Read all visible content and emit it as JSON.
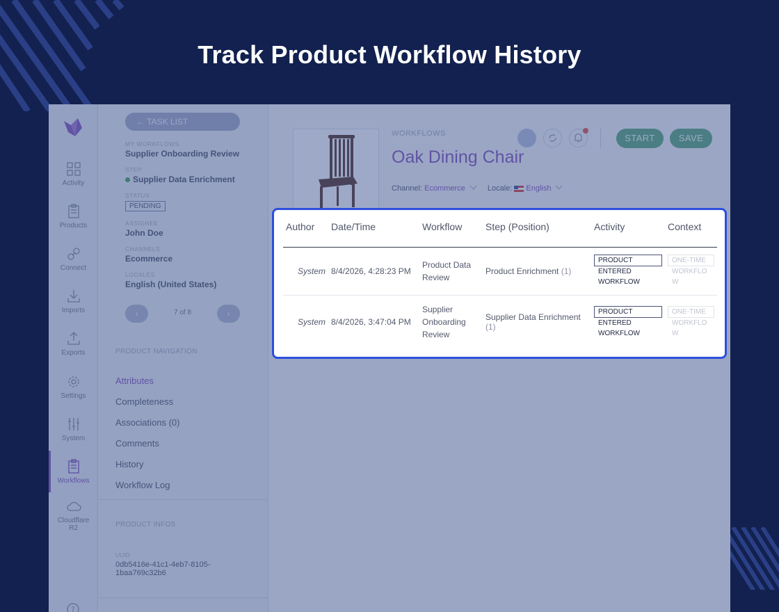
{
  "headline": "Track Product Workflow History",
  "sidebar_nav": [
    {
      "label": "Activity",
      "icon": "grid-icon"
    },
    {
      "label": "Products",
      "icon": "clipboard-icon"
    },
    {
      "label": "Connect",
      "icon": "link-icon"
    },
    {
      "label": "Imports",
      "icon": "import-icon"
    },
    {
      "label": "Exports",
      "icon": "export-icon"
    },
    {
      "label": "Settings",
      "icon": "gear-icon"
    },
    {
      "label": "System",
      "icon": "sliders-icon"
    },
    {
      "label": "Workflows",
      "icon": "workflow-clipboard-icon",
      "active": true
    },
    {
      "label": "Cloudflare R2",
      "icon": "cloud-icon"
    }
  ],
  "task_panel": {
    "back_label": "← TASK LIST",
    "my_workflows_label": "MY WORKFLOWS",
    "my_workflows_value": "Supplier Onboarding Review",
    "step_label": "STEP",
    "step_value": "Supplier Data Enrichment",
    "status_label": "STATUS",
    "status_value": "PENDING",
    "assignee_label": "ASSIGNEE",
    "assignee_value": "John Doe",
    "channels_label": "CHANNELS",
    "channels_value": "Ecommerce",
    "locales_label": "LOCALES",
    "locales_value": "English (United States)",
    "pager_prev": "‹",
    "pager_next": "›",
    "pager_count": "7 of 8"
  },
  "product_nav": {
    "title": "PRODUCT NAVIGATION",
    "items": [
      "Attributes",
      "Completeness",
      "Associations (0)",
      "Comments",
      "History",
      "Workflow Log"
    ]
  },
  "product_infos": {
    "title": "PRODUCT INFOS",
    "uuid_label": "UUID",
    "uuid_value": "0db5416e-41c1-4eb7-8105-1baa769c32b6"
  },
  "product": {
    "breadcrumb": "WORKFLOWS",
    "title": "Oak Dining Chair",
    "channel_label": "Channel:",
    "channel_value": "Ecommerce",
    "locale_label": "Locale:",
    "locale_value": "English",
    "start_label": "START",
    "save_label": "SAVE"
  },
  "history_table": {
    "columns": [
      "Author",
      "Date/Time",
      "Workflow",
      "Step (Position)",
      "Activity",
      "Context"
    ],
    "rows": [
      {
        "author": "System",
        "datetime": "8/4/2026, 4:28:23 PM",
        "workflow": "Product Data Review",
        "step": "Product Enrichment",
        "position": "(1)",
        "activity_tag": "PRODUCT",
        "activity_line2": "ENTERED",
        "activity_line3": "WORKFLOW",
        "context_tag": "ONE-TIME",
        "context_line2": "WORKFLO",
        "context_line3": "W"
      },
      {
        "author": "System",
        "datetime": "8/4/2026, 3:47:04 PM",
        "workflow": "Supplier Onboarding Review",
        "step": "Supplier Data Enrichment",
        "position": "(1)",
        "activity_tag": "PRODUCT",
        "activity_line2": "ENTERED",
        "activity_line3": "WORKFLOW",
        "context_tag": "ONE-TIME",
        "context_line2": "WORKFLO",
        "context_line3": "W"
      }
    ]
  },
  "colors": {
    "background": "#12214f",
    "accent_purple": "#7a4bb0",
    "highlight_border": "#2c4fdc",
    "action_green": "#4ea173"
  }
}
